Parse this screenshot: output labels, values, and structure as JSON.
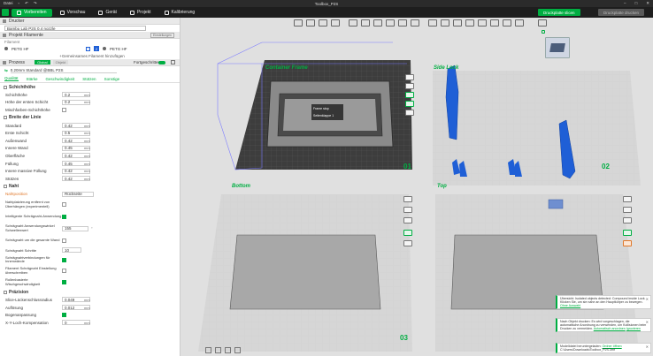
{
  "window": {
    "title": "Toolbox_P2S",
    "menu_file": "Datei"
  },
  "tabs": [
    {
      "label": "Vorbereiten",
      "active": true
    },
    {
      "label": "Vorschau",
      "active": false
    },
    {
      "label": "Gerät",
      "active": false
    },
    {
      "label": "Projekt",
      "active": false
    },
    {
      "label": "Kalibrierung",
      "active": false
    }
  ],
  "actions": {
    "slice_plate": "Druckplatte slicen",
    "print_plate": "Druckplatte drucken"
  },
  "printer": {
    "section": "Drucker",
    "name": "Bambu Lab P2S 0.4 nozzle",
    "settings_link": "Einstellungen"
  },
  "filament": {
    "section": "Projekt Filamente",
    "subtitle": "Filament",
    "slot1": "PETG HF",
    "slot2": "PETG HF",
    "slot2_num": "2",
    "add_label": "Gemeinsames Filament hinzufügen"
  },
  "process": {
    "section": "Prozess",
    "toggle_global": "Global",
    "toggle_object": "Objekt",
    "advanced_label": "Fortgeschritten",
    "preset": "0.20mm Standard @BBL P2S",
    "subtabs": [
      "Qualität",
      "Stärke",
      "Geschwindigkeit",
      "Stützen",
      "Sonstige"
    ]
  },
  "groups": {
    "layer_height": {
      "title": "Schichthöhe",
      "params": [
        {
          "label": "Schichthöhe",
          "value": "0.2",
          "unit": "mm"
        },
        {
          "label": "Höhe der ersten Schicht",
          "value": "0.2",
          "unit": "mm"
        },
        {
          "label": "Mischfarben-Schichthöhe",
          "check": false
        }
      ]
    },
    "line_width": {
      "title": "Breite der Linie",
      "params": [
        {
          "label": "Standard",
          "value": "0.42",
          "unit": "mm"
        },
        {
          "label": "Erste Schicht",
          "value": "0.5",
          "unit": "mm"
        },
        {
          "label": "Außenwand",
          "value": "0.42",
          "unit": "mm"
        },
        {
          "label": "Innere Wand",
          "value": "0.45",
          "unit": "mm"
        },
        {
          "label": "Oberfläche",
          "value": "0.42",
          "unit": "mm"
        },
        {
          "label": "Füllung",
          "value": "0.45",
          "unit": "mm"
        },
        {
          "label": "Innere massive Füllung",
          "value": "0.42",
          "unit": "mm"
        },
        {
          "label": "Stützen",
          "value": "0.42",
          "unit": "mm"
        }
      ]
    },
    "seam": {
      "title": "Naht",
      "params": [
        {
          "label": "Nahtposition",
          "value": "Rückseite",
          "warn": true
        },
        {
          "label": "Nahtplatzierung entfernt von Überhängen (experimentell)",
          "check": false
        },
        {
          "label": "Intelligente Schrägnaht-Anwendung",
          "check": true
        },
        {
          "label": "Schrägnaht Anwendungswinkel Schwellenwert",
          "value": "155",
          "unit": "°"
        },
        {
          "label": "Schrägnaht um die gesamte Wand",
          "check": false
        },
        {
          "label": "Schrägnaht Schritte",
          "value": "10"
        },
        {
          "label": "Schrägnahtverbindungen für Innenwände",
          "check": true
        },
        {
          "label": "Filament Schrägnaht Einstellung überschreiben",
          "check": false
        },
        {
          "label": "Rollenbasierte Wischgeschwindigkeit",
          "check": true
        }
      ]
    },
    "precision": {
      "title": "Präzision",
      "params": [
        {
          "label": "Slice-Lückenschlussradius",
          "value": "0.049",
          "unit": "mm"
        },
        {
          "label": "Auflösung",
          "value": "0.012",
          "unit": "mm"
        },
        {
          "label": "Bogenanpassung",
          "check": true
        },
        {
          "label": "X-Y-Loch-Kompensation",
          "value": "0",
          "unit": "mm"
        }
      ]
    }
  },
  "plates": [
    {
      "label": "Container Frame",
      "num": "01"
    },
    {
      "label": "Side Lock",
      "num": "02"
    },
    {
      "label": "Bottom",
      "num": "03"
    },
    {
      "label": "Top",
      "num": "04"
    }
  ],
  "tooltip": {
    "line1": "Frame stop",
    "line2": "Seitenklappe 1"
  },
  "toasts": [
    {
      "text": "Übersicht: Isolated objects detected: Compound inside Lock. Klicken Sie, um sie nahe an den Hauptkörper zu bewegen. ",
      "link": "Ohne Auswahl"
    },
    {
      "text": "Nach Objekt drucken: Es wird vorgeschlagen, die automatische Anordnung zu verwenden, um Kollisionen beim Drucken zu vermeiden. ",
      "link": "Automatisch anordnen",
      "link2": "Ignorieren"
    },
    {
      "text": "Modelldatei heruntergeladen: ",
      "link": "Ordner öffnen",
      "path": "C:\\Users\\Downloads\\Toolbox_P2S.3mf"
    }
  ],
  "colors": {
    "accent": "#00ae42",
    "part": "#1f5fd6",
    "plate": "#3d3d3d"
  }
}
